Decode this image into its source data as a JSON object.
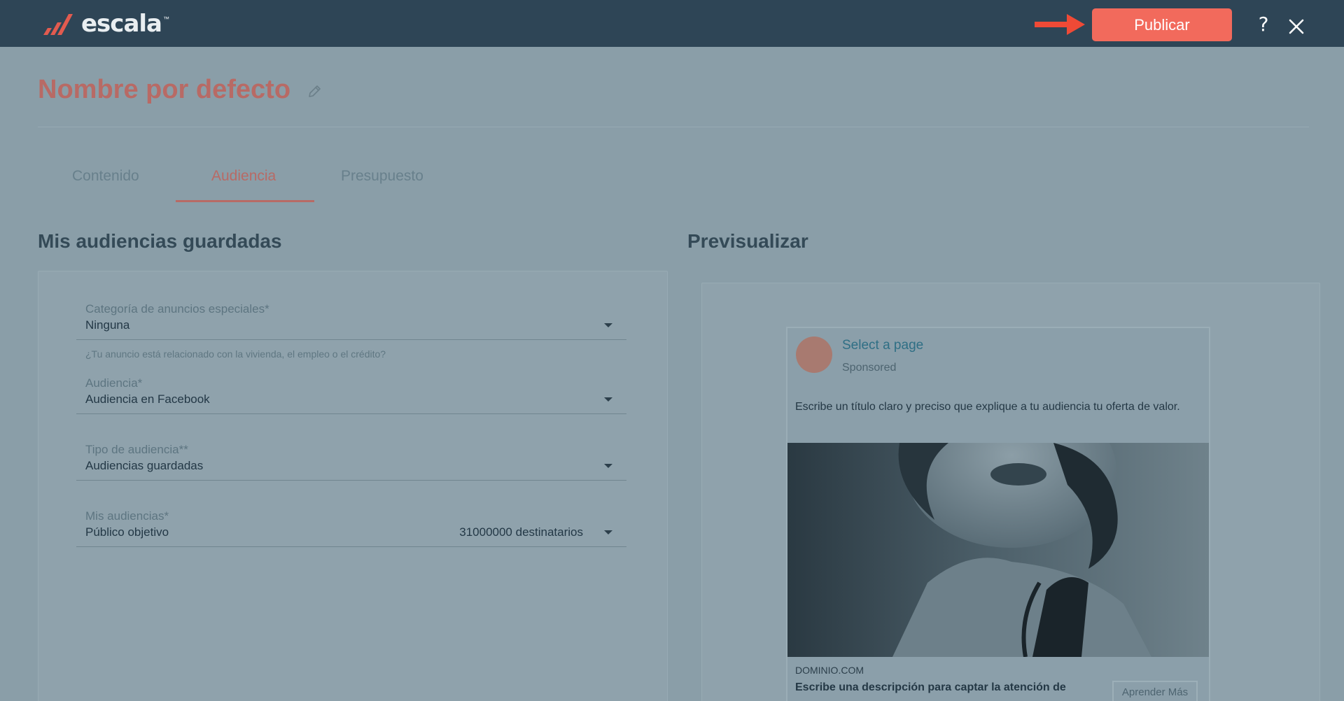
{
  "header": {
    "logo_text": "escala",
    "logo_tm": "™",
    "publish_label": "Publicar",
    "help_label": "?"
  },
  "page": {
    "title": "Nombre por defecto"
  },
  "tabs": [
    {
      "label": "Contenido",
      "active": false
    },
    {
      "label": "Audiencia",
      "active": true
    },
    {
      "label": "Presupuesto",
      "active": false
    }
  ],
  "saved_audiences": {
    "title": "Mis audiencias guardadas",
    "fields": [
      {
        "label": "Categoría de anuncios especiales*",
        "value": "Ninguna"
      },
      {
        "label": "Audiencia*",
        "value": "Audiencia en Facebook"
      },
      {
        "label": "Tipo de audiencia**",
        "value": "Audiencias guardadas"
      },
      {
        "label": "Mis audiencias*",
        "value": "Público objetivo",
        "count": "31000000 destinatarios"
      }
    ],
    "helper_text": "¿Tu anuncio está relacionado con la vivienda, el empleo o el crédito?"
  },
  "preview": {
    "title": "Previsualizar",
    "page_name": "Select a page",
    "sponsored": "Sponsored",
    "headline": "Escribe un título claro y preciso que explique a tu audiencia tu oferta de valor.",
    "domain": "DOMINIO.COM",
    "description": "Escribe una descripción para captar la atención de",
    "cta_label": "Aprender Más"
  },
  "colors": {
    "topbar": "#2e4556",
    "accent": "#f26a5c",
    "title": "#b86a65",
    "overlay": "#8a9ea8"
  }
}
